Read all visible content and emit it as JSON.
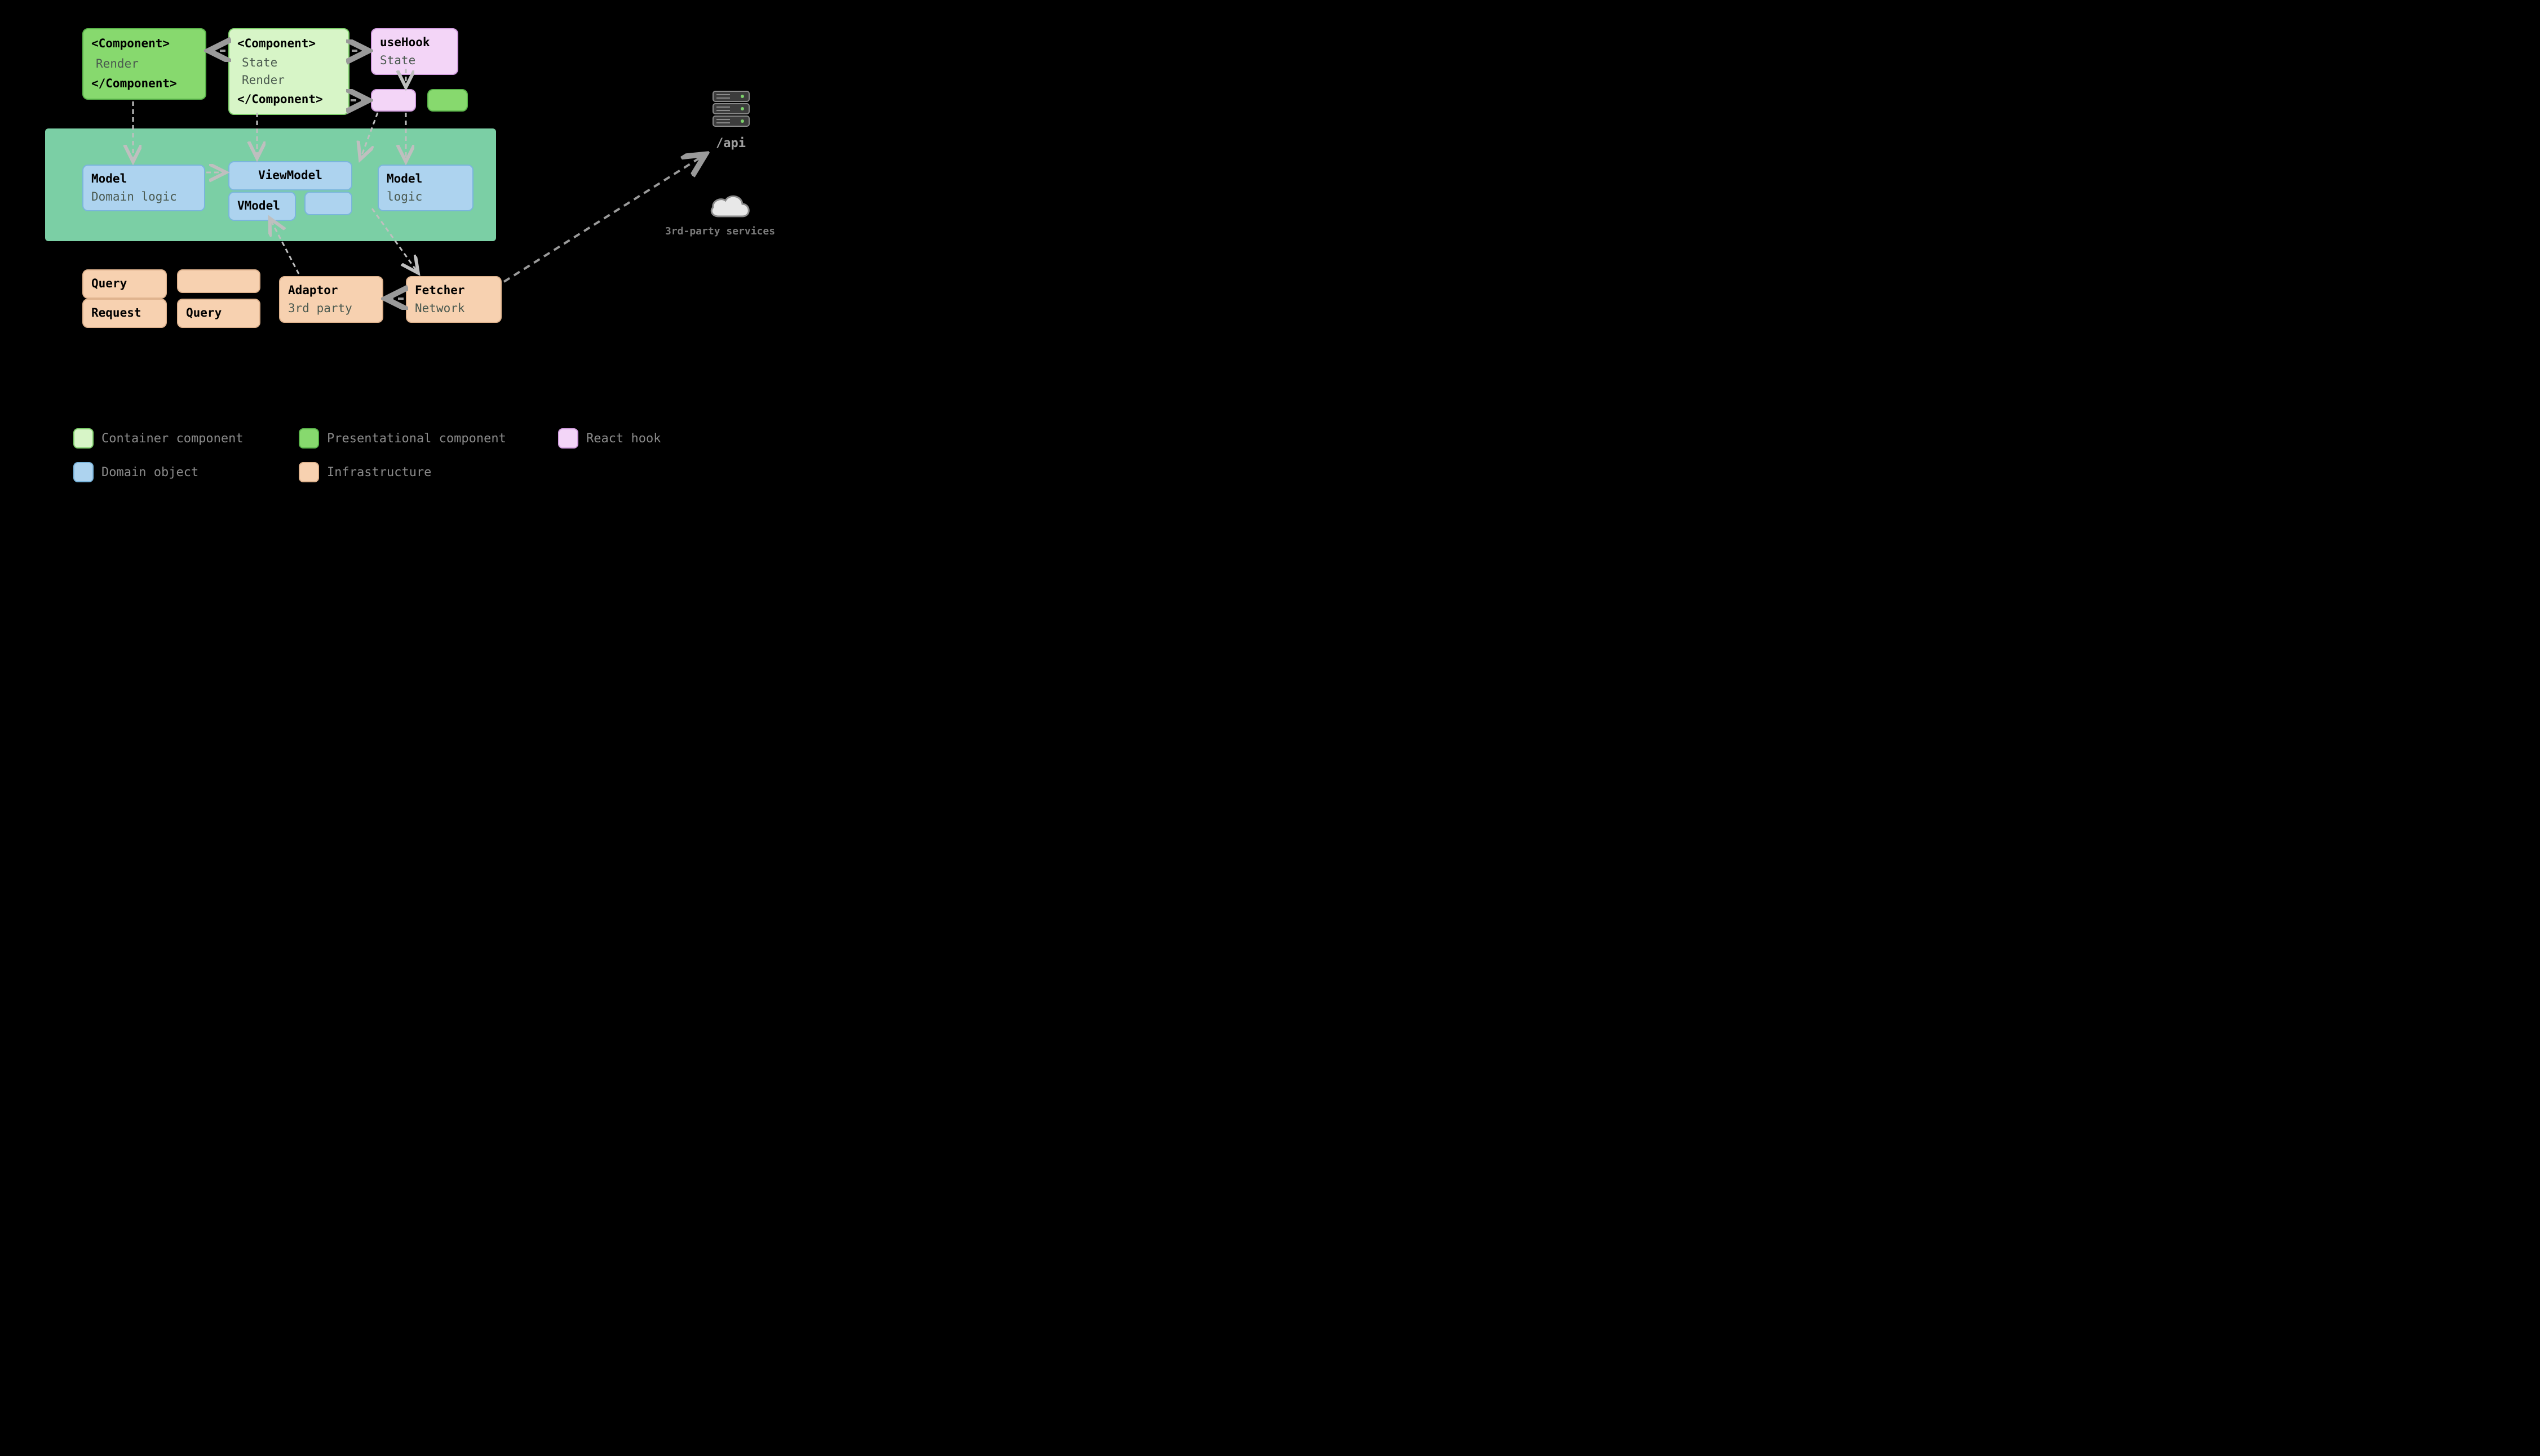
{
  "colors": {
    "container_component": "#d7f5c7",
    "presentational_component": "#87d96e",
    "react_hook": "#f3d5f7",
    "domain_object": "#add3ef",
    "infrastructure": "#f7d1b0",
    "domain_panel": "#7bcfa5",
    "arrow_internal": "#bfbfbf",
    "arrow_external": "#9a9a9a"
  },
  "nodes": {
    "presentational": {
      "open": "<Component>",
      "body": "Render",
      "close": "</Component>"
    },
    "container": {
      "open": "<Component>",
      "body1": "State",
      "body2": "Render",
      "close": "</Component>"
    },
    "hook": {
      "title": "useHook",
      "body": "State"
    },
    "model1": {
      "title": "Model",
      "body": "Domain logic"
    },
    "viewmodel": "ViewModel",
    "vmodel": "VModel",
    "model2": {
      "title": "Model",
      "body": "logic"
    },
    "query1": "Query",
    "request": "Request",
    "query2": "Query",
    "adaptor": {
      "title": "Adaptor",
      "body": "3rd party"
    },
    "fetcher": {
      "title": "Fetcher",
      "body": "Network"
    }
  },
  "external": {
    "api": "/api",
    "services": "3rd-party services"
  },
  "legend": {
    "container": "Container component",
    "presentational": "Presentational component",
    "hook": "React hook",
    "domain": "Domain object",
    "infra": "Infrastructure"
  }
}
